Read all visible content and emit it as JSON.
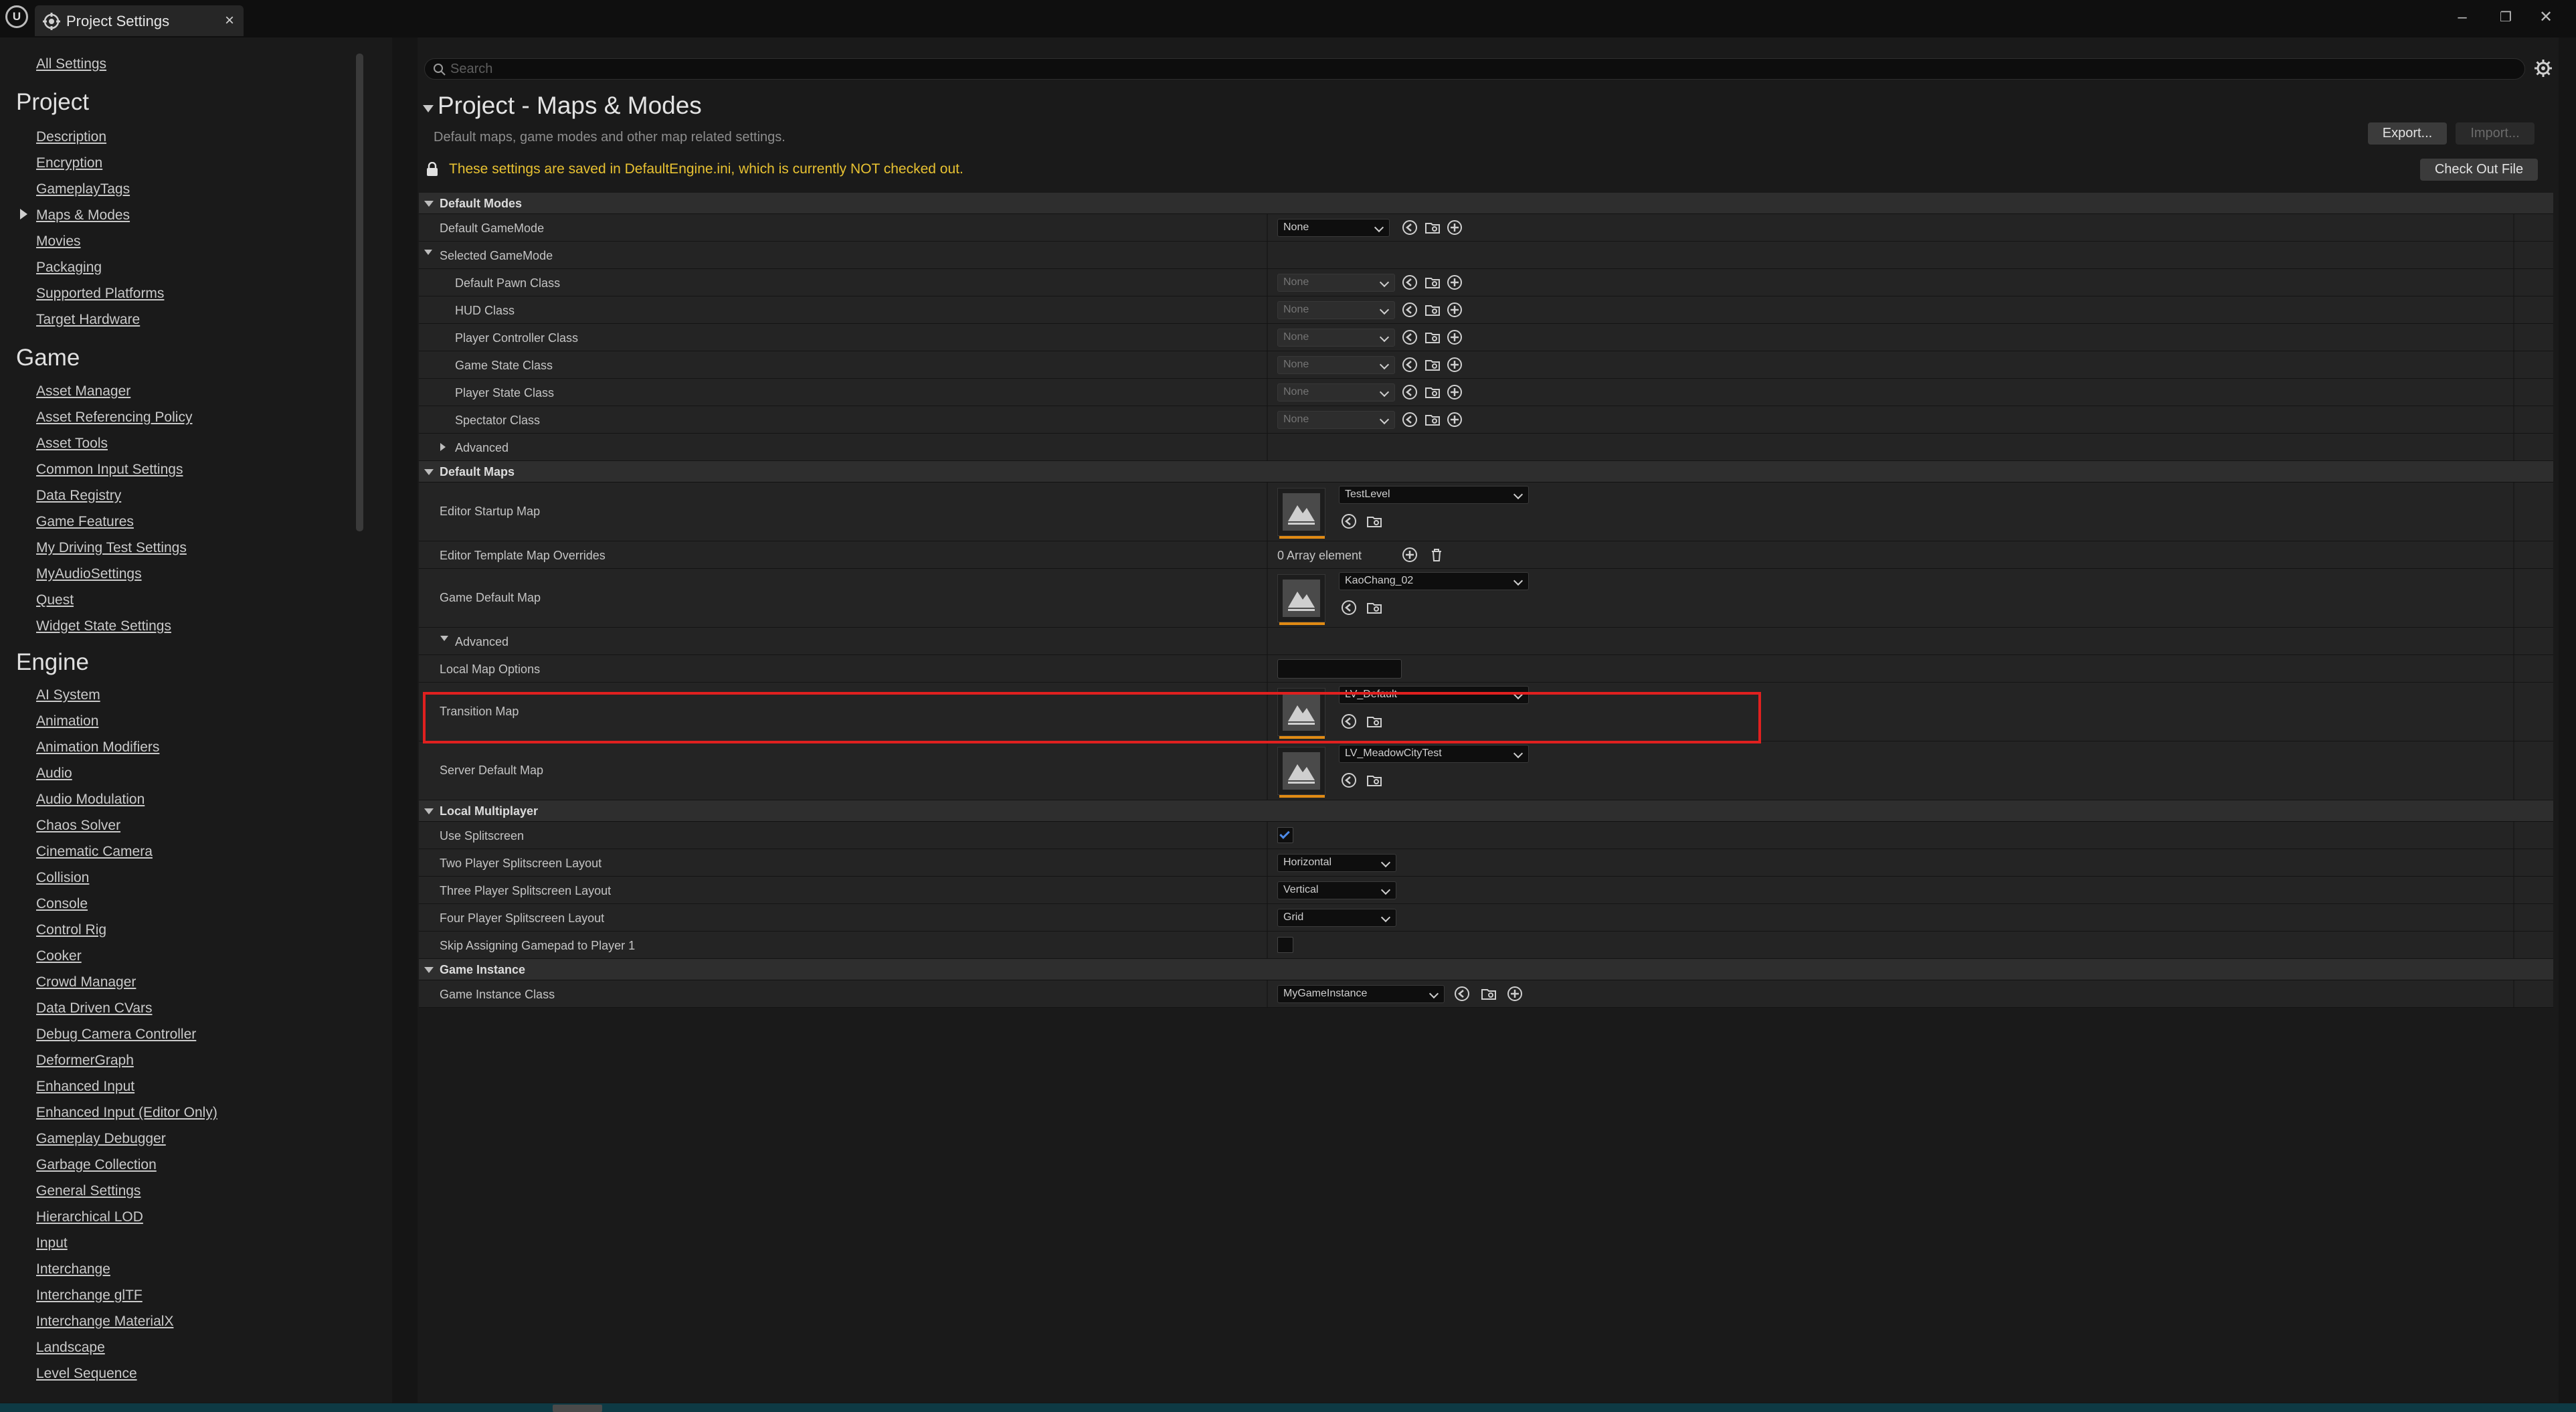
{
  "window": {
    "tab_label": "Project Settings",
    "logo_text": "U"
  },
  "sidebar": {
    "all_settings": "All Settings",
    "sections": [
      {
        "title": "Project",
        "items": [
          "Description",
          "Encryption",
          "GameplayTags",
          "Maps & Modes",
          "Movies",
          "Packaging",
          "Supported Platforms",
          "Target Hardware"
        ]
      },
      {
        "title": "Game",
        "items": [
          "Asset Manager",
          "Asset Referencing Policy",
          "Asset Tools",
          "Common Input Settings",
          "Data Registry",
          "Game Features",
          "My Driving Test Settings",
          "MyAudioSettings",
          "Quest",
          "Widget State Settings"
        ]
      },
      {
        "title": "Engine",
        "items": [
          "AI System",
          "Animation",
          "Animation Modifiers",
          "Audio",
          "Audio Modulation",
          "Chaos Solver",
          "Cinematic Camera",
          "Collision",
          "Console",
          "Control Rig",
          "Cooker",
          "Crowd Manager",
          "Data Driven CVars",
          "Debug Camera Controller",
          "DeformerGraph",
          "Enhanced Input",
          "Enhanced Input (Editor Only)",
          "Gameplay Debugger",
          "Garbage Collection",
          "General Settings",
          "Hierarchical LOD",
          "Input",
          "Interchange",
          "Interchange glTF",
          "Interchange MaterialX",
          "Landscape",
          "Level Sequence"
        ]
      }
    ],
    "selected": "Maps & Modes"
  },
  "search": {
    "placeholder": "Search"
  },
  "page": {
    "title": "Project - Maps & Modes",
    "description": "Default maps, game modes and other map related settings.",
    "export_label": "Export...",
    "import_label": "Import...",
    "checkout_label": "Check Out File",
    "warning": "These settings are saved in DefaultEngine.ini, which is currently NOT checked out."
  },
  "props": {
    "default_modes": "Default Modes",
    "default_gamemode": {
      "label": "Default GameMode",
      "value": "None"
    },
    "selected_gamemode": "Selected GameMode",
    "selected_items": [
      {
        "label": "Default Pawn Class",
        "value": "None"
      },
      {
        "label": "HUD Class",
        "value": "None"
      },
      {
        "label": "Player Controller Class",
        "value": "None"
      },
      {
        "label": "Game State Class",
        "value": "None"
      },
      {
        "label": "Player State Class",
        "value": "None"
      },
      {
        "label": "Spectator Class",
        "value": "None"
      }
    ],
    "advanced": "Advanced",
    "default_maps": "Default Maps",
    "editor_startup_map": {
      "label": "Editor Startup Map",
      "value": "TestLevel"
    },
    "editor_template_overrides": {
      "label": "Editor Template Map Overrides",
      "value": "0 Array element"
    },
    "game_default_map": {
      "label": "Game Default Map",
      "value": "KaoChang_02"
    },
    "advanced2": "Advanced",
    "local_map_options": {
      "label": "Local Map Options",
      "value": ""
    },
    "transition_map": {
      "label": "Transition Map",
      "value": "LV_Default"
    },
    "server_default_map": {
      "label": "Server Default Map",
      "value": "LV_MeadowCityTest"
    },
    "local_multiplayer": "Local Multiplayer",
    "use_splitscreen": {
      "label": "Use Splitscreen",
      "checked": true
    },
    "two_player": {
      "label": "Two Player Splitscreen Layout",
      "value": "Horizontal"
    },
    "three_player": {
      "label": "Three Player Splitscreen Layout",
      "value": "Vertical"
    },
    "four_player": {
      "label": "Four Player Splitscreen Layout",
      "value": "Grid"
    },
    "skip_gamepad": {
      "label": "Skip Assigning Gamepad to Player 1",
      "checked": false
    },
    "game_instance": "Game Instance",
    "game_instance_class": {
      "label": "Game Instance Class",
      "value": "MyGameInstance"
    }
  },
  "colors": {
    "accent_orange": "#e08a14",
    "warning_yellow": "#e8c232",
    "highlight_red": "#e0201f",
    "check_blue": "#4d8ae8"
  }
}
